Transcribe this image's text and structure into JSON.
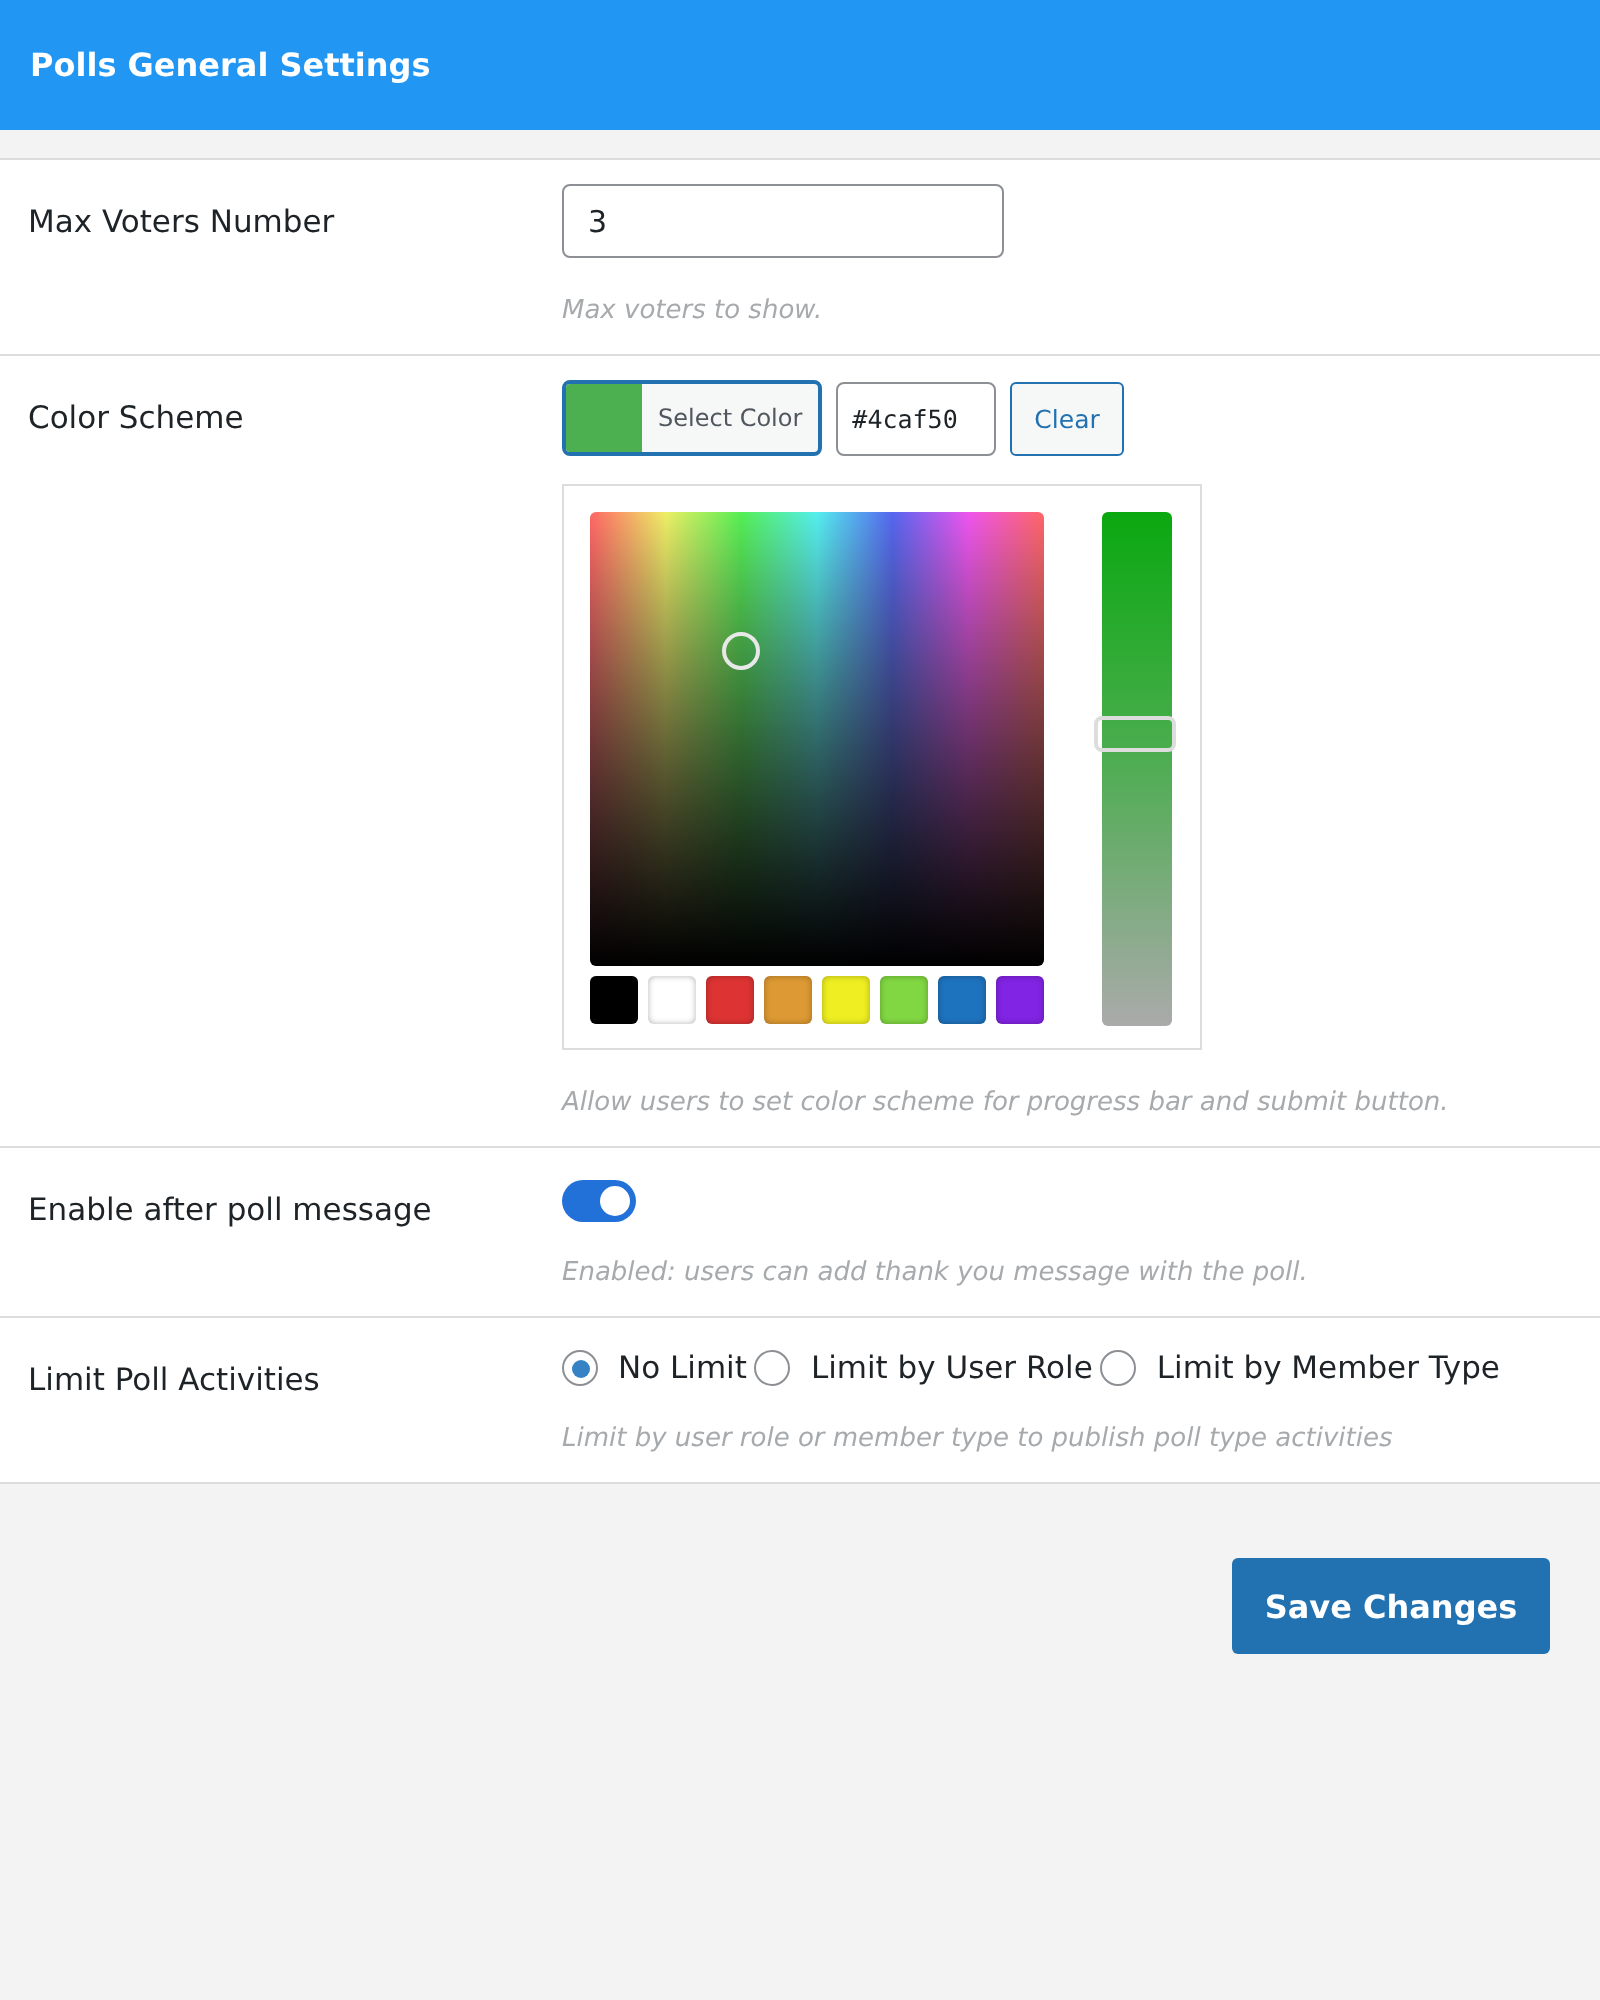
{
  "header": {
    "title": "Polls General Settings"
  },
  "settings": [
    {
      "kind": "number",
      "label": "Max Voters Number",
      "value": "3",
      "description": "Max voters to show."
    },
    {
      "kind": "color",
      "label": "Color Scheme",
      "color": "#4caf50",
      "select_label": "Select Color",
      "hex_value": "#4caf50",
      "clear_label": "Clear",
      "picker": {
        "open": true,
        "saturation_slider": {
          "level": 0.57
        },
        "swatches": [
          {
            "color": "#000000"
          },
          {
            "color": "#ffffff"
          },
          {
            "color": "#dd3333"
          },
          {
            "color": "#dd9933"
          },
          {
            "color": "#eeee22"
          },
          {
            "color": "#81d742"
          },
          {
            "color": "#1e73be"
          },
          {
            "color": "#8224e3"
          }
        ]
      },
      "description": "Allow users to set color scheme for progress bar and submit button."
    },
    {
      "kind": "toggle",
      "label": "Enable after poll message",
      "on": true,
      "description": "Enabled: users can add thank you message with the poll."
    },
    {
      "kind": "radio",
      "label": "Limit Poll Activities",
      "options": [
        {
          "label": "No Limit",
          "selected": true
        },
        {
          "label": "Limit by User Role",
          "selected": false
        },
        {
          "label": "Limit by Member Type",
          "selected": false
        }
      ],
      "description": "Limit by user role or member type to publish poll type activities"
    }
  ],
  "save_button": "Save Changes"
}
